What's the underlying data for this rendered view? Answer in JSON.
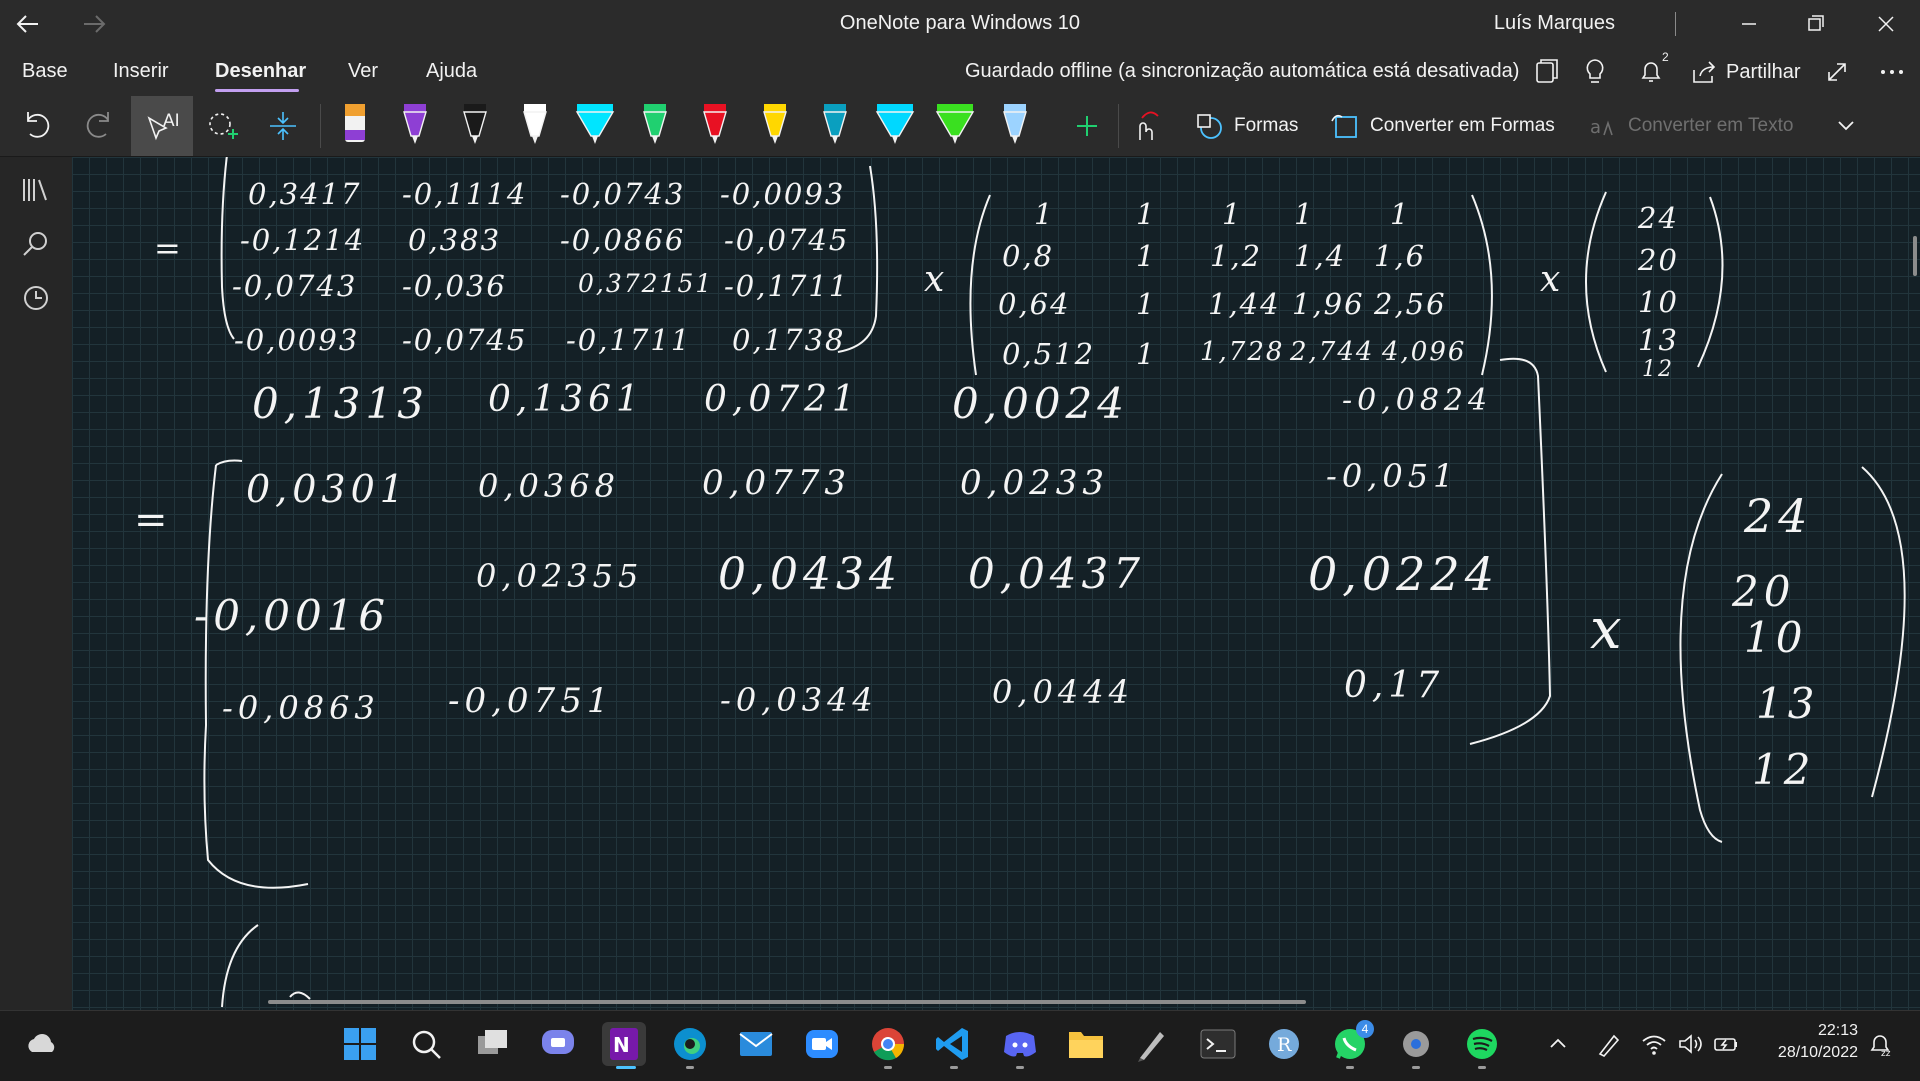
{
  "titlebar": {
    "app_title": "OneNote para Windows 10",
    "user_name": "Luís Marques"
  },
  "ribbon": {
    "tabs": [
      "Base",
      "Inserir",
      "Desenhar",
      "Ver",
      "Ajuda"
    ],
    "active_tab": "Desenhar",
    "sync_status": "Guardado offline (a sincronização automática está desativada)",
    "share_label": "Partilhar",
    "notification_count": "2",
    "accent_color": "#c29ff0"
  },
  "draw_toolbar": {
    "pens": [
      {
        "name": "highlighter-orange",
        "color": "#f0a030"
      },
      {
        "name": "pen-purple",
        "color": "#8e3fd4"
      },
      {
        "name": "pen-black",
        "color": "#1a1a1a"
      },
      {
        "name": "pen-white",
        "color": "#ffffff"
      },
      {
        "name": "pen-cyan-wide",
        "color": "#00e5ff"
      },
      {
        "name": "pen-green",
        "color": "#20d070"
      },
      {
        "name": "pen-red",
        "color": "#e81123"
      },
      {
        "name": "pen-yellow",
        "color": "#ffd700"
      },
      {
        "name": "pen-teal",
        "color": "#0a9fbf"
      },
      {
        "name": "pen-aqua-wide",
        "color": "#00d8ff"
      },
      {
        "name": "pen-lime-wide",
        "color": "#3ae020"
      },
      {
        "name": "pen-light-blue",
        "color": "#9cd3ff"
      }
    ],
    "formas_label": "Formas",
    "convert_shapes_label": "Converter em Formas",
    "convert_text_label": "Converter em Texto"
  },
  "canvas": {
    "equals": "=",
    "times": "x",
    "matrix1": [
      [
        "0,3417",
        "-0,1114",
        "-0,0743",
        "-0,0093"
      ],
      [
        "-0,1214",
        "0,383",
        "-0,0866",
        "-0,0745"
      ],
      [
        "-0,0743",
        "-0,036",
        "0,372151",
        "-0,1711"
      ],
      [
        "-0,0093",
        "-0,0745",
        "-0,1711",
        "0,1738"
      ]
    ],
    "matrix2": [
      [
        "1",
        "1",
        "1",
        "1",
        "1"
      ],
      [
        "0,8",
        "1",
        "1,2",
        "1,4",
        "1,6"
      ],
      [
        "0,64",
        "1",
        "1,44",
        "1,96",
        "2,56"
      ],
      [
        "0,512",
        "1",
        "1,728",
        "2,744",
        "4,096"
      ]
    ],
    "vector1": [
      "24",
      "20",
      "10",
      "13",
      "12"
    ],
    "matrix3": [
      [
        "0,1313",
        "0,1361",
        "0,0721",
        "0,0024",
        "-0,0824"
      ],
      [
        "0,0301",
        "0,0368",
        "0,0773",
        "0,0233",
        "-0,051"
      ],
      [
        "-0,0016",
        "0,02355",
        "0,0434",
        "0,0437",
        "0,0224"
      ],
      [
        "-0,0863",
        "-0,0751",
        "-0,0344",
        "0,0444",
        "0,17"
      ]
    ],
    "vector2": [
      "24",
      "20",
      "10",
      "13",
      "12"
    ]
  },
  "taskbar": {
    "apps": [
      "start",
      "search",
      "task-view",
      "teams",
      "onenote",
      "edge",
      "mail",
      "zoom",
      "chrome",
      "vscode",
      "discord",
      "file-explorer",
      "pen-app",
      "terminal",
      "r-app",
      "whatsapp",
      "settings",
      "spotify"
    ],
    "whatsapp_badge": "4",
    "time": "22:13",
    "date": "28/10/2022"
  }
}
